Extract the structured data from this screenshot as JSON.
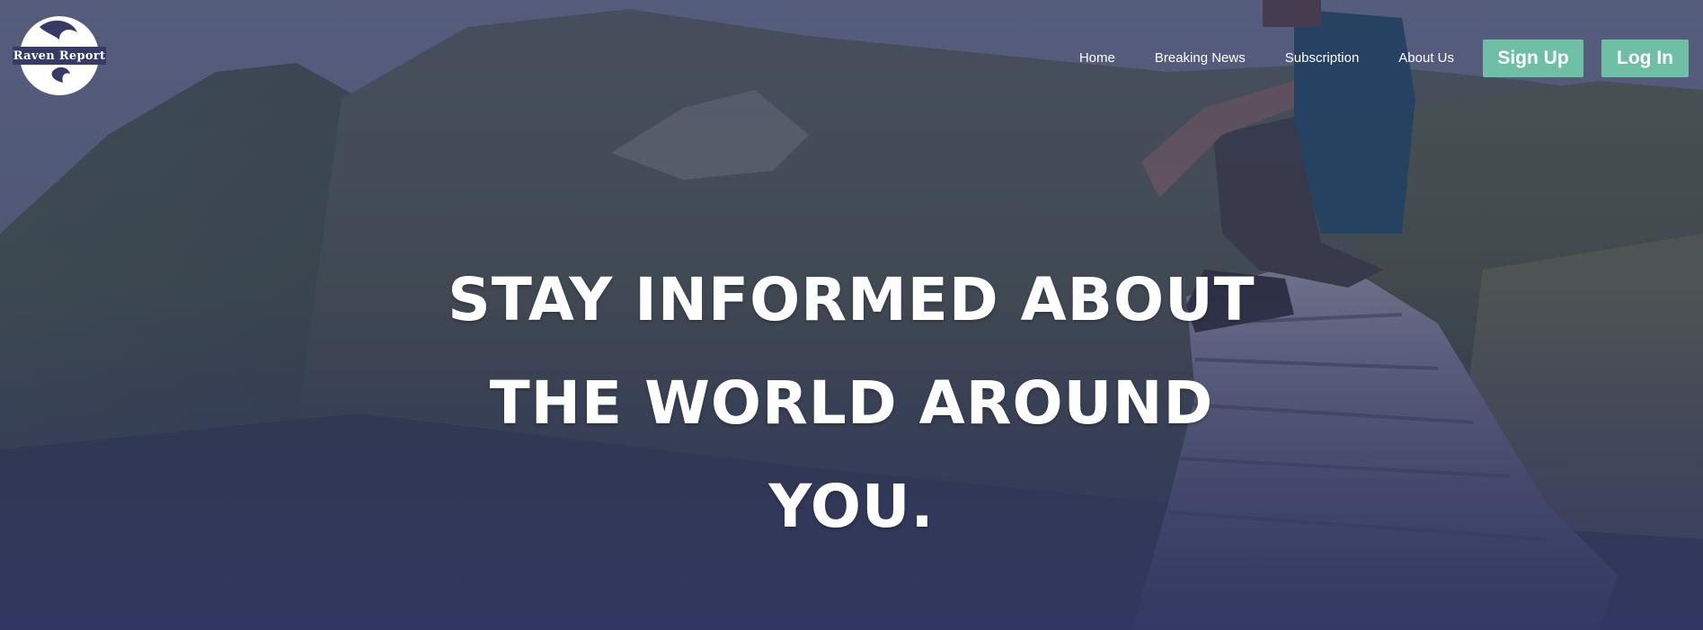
{
  "logo": {
    "text": "Raven Report"
  },
  "nav": {
    "links": [
      "Home",
      "Breaking News",
      "Subscription",
      "About Us"
    ],
    "signup_label": "Sign Up",
    "login_label": "Log In"
  },
  "hero": {
    "headline_lines": [
      "STAY INFORMED ABOUT",
      "THE WORLD AROUND",
      "YOU."
    ]
  },
  "colors": {
    "overlay": "#343864",
    "button": "#6fbfa7",
    "text": "#ffffff"
  }
}
